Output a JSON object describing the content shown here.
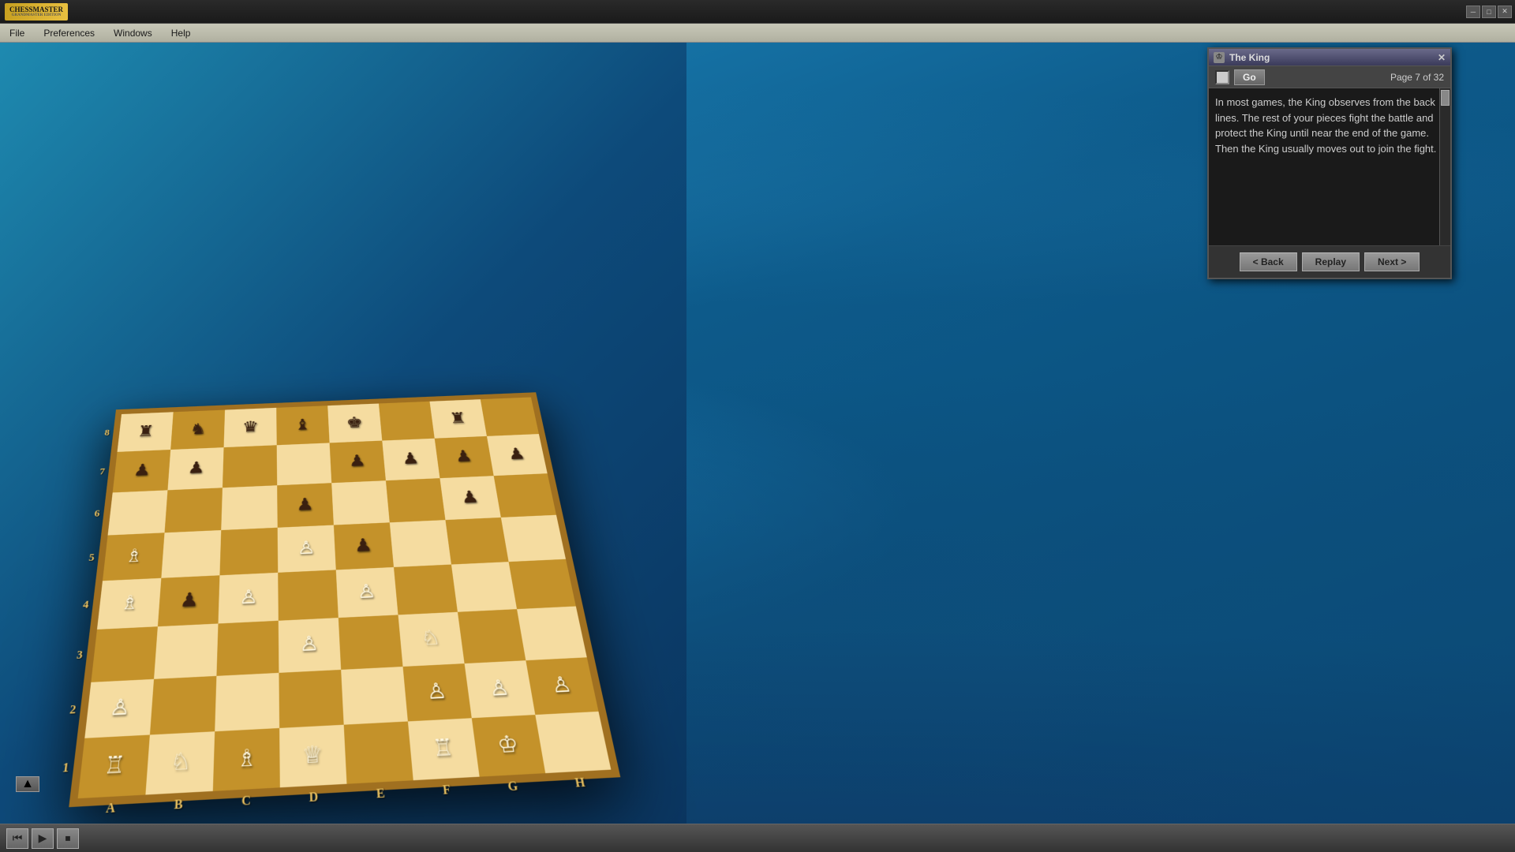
{
  "app": {
    "title": "Chessmaster Grandmaster Edition",
    "logo": "CHESSMASTER",
    "logo_sub": "GRANDMASTER EDITION"
  },
  "titlebar": {
    "minimize": "─",
    "maximize": "□",
    "close": "✕"
  },
  "menubar": {
    "items": [
      "File",
      "Preferences",
      "Windows",
      "Help"
    ]
  },
  "panel": {
    "title": "The King",
    "close": "✕",
    "go_label": "Go",
    "page_info": "Page 7 of 32",
    "content": "In most games, the King observes from the back lines. The rest of your pieces fight the battle and protect the King until near the end of the game. Then the King usually moves out to join the fight.",
    "buttons": {
      "back": "< Back",
      "replay": "Replay",
      "next": "Next >"
    }
  },
  "board": {
    "rank_labels": [
      "8",
      "7",
      "6",
      "5",
      "4",
      "3",
      "2",
      "1"
    ],
    "file_labels": [
      "A",
      "B",
      "C",
      "D",
      "E",
      "F",
      "G",
      "H"
    ]
  },
  "toolbar": {
    "buttons": [
      "▲",
      "▶",
      "■"
    ]
  }
}
